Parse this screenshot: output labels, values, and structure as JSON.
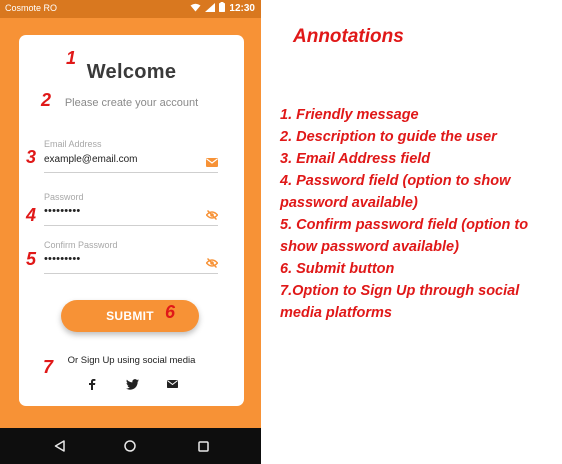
{
  "status_bar": {
    "carrier": "Cosmote RO",
    "time": "12:30",
    "icons": [
      "wifi-icon",
      "signal-icon",
      "battery-icon"
    ]
  },
  "form": {
    "title": "Welcome",
    "subtitle": "Please create your account",
    "email": {
      "label": "Email Address",
      "value": "example@email.com",
      "icon": "mail-icon"
    },
    "password": {
      "label": "Password",
      "value": "•••••••••",
      "icon": "eye-off-icon"
    },
    "confirm_password": {
      "label": "Confirm Password",
      "value": "•••••••••",
      "icon": "eye-off-icon"
    },
    "submit_label": "SUBMIT",
    "social_text": "Or Sign Up using social media",
    "social_icons": [
      "facebook-icon",
      "twitter-icon",
      "email-icon"
    ]
  },
  "nav_bar": {
    "icons": [
      "back-icon",
      "home-icon",
      "recents-icon"
    ]
  },
  "markers": [
    "1",
    "2",
    "3",
    "4",
    "5",
    "6",
    "7"
  ],
  "annotations": {
    "title": "Annotations",
    "items": [
      "1. Friendly message",
      "2. Description to guide the user",
      "3. Email Address field",
      "4. Password field (option to show password available)",
      "5. Confirm password field (option to show password available)",
      "6. Submit button",
      "7.Option to Sign Up through social media platforms"
    ]
  },
  "colors": {
    "brand_orange": "#f79236",
    "status_bar": "#d9781f",
    "annotation_red": "#e01818",
    "nav_bar": "#0e0e0e"
  }
}
